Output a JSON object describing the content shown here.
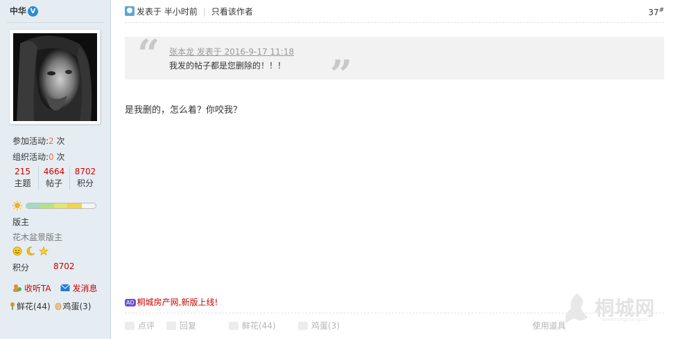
{
  "user": {
    "name": "中华",
    "verified_badge": "V",
    "activities": [
      {
        "label": "参加活动:",
        "value": "2",
        "unit": "次"
      },
      {
        "label": "组织活动:",
        "value": "0",
        "unit": "次"
      }
    ],
    "counts": [
      {
        "value": "215",
        "label": "主题"
      },
      {
        "value": "4664",
        "label": "帖子"
      },
      {
        "value": "8702",
        "label": "积分"
      }
    ],
    "level_icon": "sun-icon",
    "rank": "版主",
    "rank_title": "花木盆景版主",
    "medals": [
      "smile-medal-icon",
      "moon-medal-icon",
      "star-medal-icon"
    ],
    "score_label": "积分",
    "score_value": "8702",
    "follow_label": "收听TA",
    "message_label": "发消息",
    "flowers_label": "鲜花(44)",
    "eggs_label": "鸡蛋(3)"
  },
  "post": {
    "posted_label": "发表于 半小时前",
    "only_author_label": "只看该作者",
    "floor_number": "37",
    "floor_suffix": "#",
    "quote_author": "张本龙 发表于 2016-9-17 11:18",
    "quote_text": "我发的帖子都是您删除的！！！",
    "reply_text": "是我删的，怎么着？你咬我？",
    "ad_tag": "AD",
    "ad_text": "桐城房产网,新版上线!"
  },
  "footer": {
    "rate_label": "点评",
    "reply_label": "回复",
    "flowers_label": "鲜花(44)",
    "eggs_label": "鸡蛋(3)",
    "tools_label": "使用道具"
  },
  "watermark": {
    "text": "桐城网",
    "sub": "www.tongcheng.cc"
  },
  "colors": {
    "sidebar_bg": "#e5edf2",
    "accent_red": "#c00",
    "count_orange": "#f26c4f",
    "quote_bg": "#f2f2f2"
  }
}
